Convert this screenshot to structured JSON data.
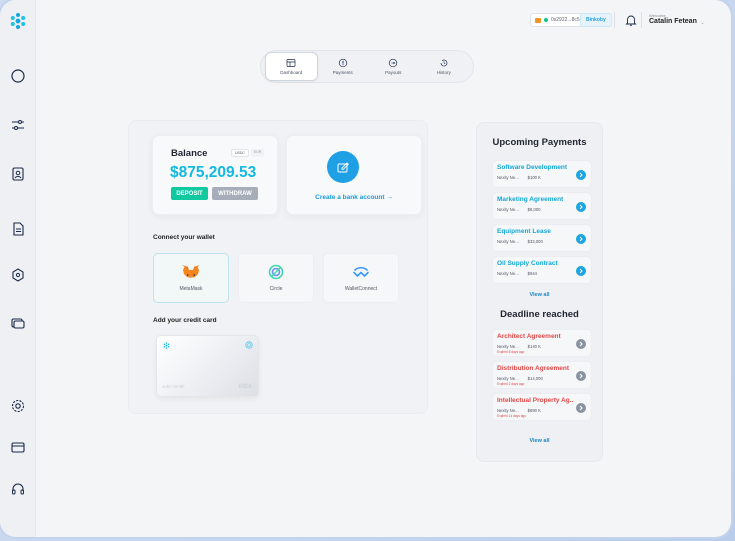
{
  "topbar": {
    "wallet_address": "0x2922...8c51",
    "network": "Binkoby",
    "welcome_label": "Welcome",
    "user_name": "Catalin Fetean"
  },
  "tabs": [
    {
      "label": "Dashboard",
      "icon": "dashboard-icon",
      "active": true
    },
    {
      "label": "Payments",
      "icon": "payments-icon",
      "active": false
    },
    {
      "label": "Payouts",
      "icon": "payouts-icon",
      "active": false
    },
    {
      "label": "History",
      "icon": "history-icon",
      "active": false
    }
  ],
  "balance": {
    "title": "Balance",
    "currency_options": [
      "USDC",
      "EUR"
    ],
    "amount": "$875,209.53",
    "deposit_label": "DEPOSIT",
    "withdraw_label": "WITHDRAW"
  },
  "bank": {
    "label": "Create a bank account  →"
  },
  "wallets": {
    "section_label": "Connect your wallet",
    "items": [
      {
        "label": "MetaMask",
        "icon": "metamask-icon"
      },
      {
        "label": "Circle",
        "icon": "circle-icon"
      },
      {
        "label": "WalletConnect",
        "icon": "walletconnect-icon"
      }
    ]
  },
  "credit_card": {
    "section_label": "Add your credit card",
    "holder": "John Smith",
    "brand": "VISA"
  },
  "upcoming": {
    "title": "Upcoming Payments",
    "items": [
      {
        "title": "Software Development",
        "company": "Nexity Ne...",
        "amount": "$100 K"
      },
      {
        "title": "Marketing Agreement",
        "company": "Nexity Ne...",
        "amount": "$8,000"
      },
      {
        "title": "Equipment Lease",
        "company": "Nexity Ne...",
        "amount": "$32,000"
      },
      {
        "title": "Oil Supply Contract",
        "company": "Nexity Ne...",
        "amount": "$944"
      }
    ],
    "view_all": "View all"
  },
  "deadline": {
    "title": "Deadline reached",
    "items": [
      {
        "title": "Architect Agreement",
        "company": "Nexity Ne...",
        "amount": "$140 K",
        "expired": "Expired 6 days ago"
      },
      {
        "title": "Distribution Agreement",
        "company": "Nexity Ne...",
        "amount": "$14,000",
        "expired": "Expired 2 days ago"
      },
      {
        "title": "Intellectual Property Ag...",
        "company": "Nexity Ne...",
        "amount": "$890 K",
        "expired": "Expired 14 days ago"
      }
    ],
    "view_all": "View all"
  },
  "colors": {
    "accent": "#13b9e0",
    "deposit": "#10c9a0",
    "alert": "#e24848"
  }
}
